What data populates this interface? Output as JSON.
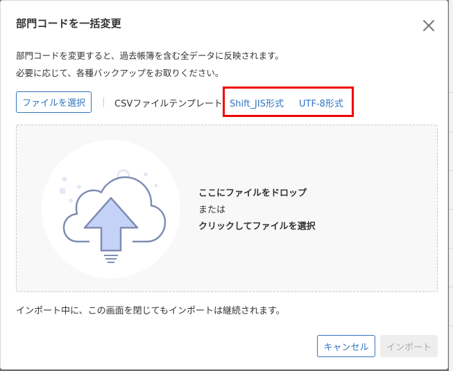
{
  "dialog": {
    "title": "部門コードを一括変更",
    "description_line1": "部門コードを変更すると、過去帳簿を含む全データに反映されます。",
    "description_line2": "必要に応じて、各種バックアップをお取りください。"
  },
  "toolbar": {
    "file_select_label": "ファイルを選択",
    "template_label": "CSVファイルテンプレート",
    "template_links": [
      "Shift_JIS形式",
      "UTF-8形式"
    ]
  },
  "dropzone": {
    "line1": "ここにファイルをドロップ",
    "line2": "または",
    "line3": "クリックしてファイルを選択"
  },
  "notice": "インポート中に、この画面を閉じてもインポートは継続されます。",
  "footer": {
    "cancel_label": "キャンセル",
    "import_label": "インポート",
    "import_enabled": false
  },
  "colors": {
    "accent": "#2f74c0",
    "highlight": "#ee0000",
    "illustration_arrow": "#c5d2f7",
    "illustration_stroke": "#7e8cb2"
  }
}
